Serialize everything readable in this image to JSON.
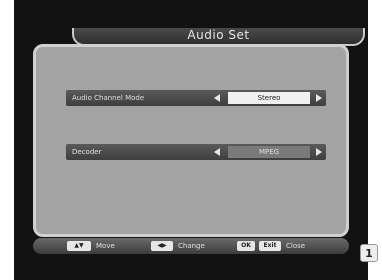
{
  "title": "Audio Set",
  "settings": [
    {
      "label": "Audio Channel Mode",
      "value": "Stereo"
    },
    {
      "label": "Decoder",
      "value": "MPEG"
    }
  ],
  "footer": {
    "move_key": "▲▼",
    "move_label": "Move",
    "change_key": "◀▶",
    "change_label": "Change",
    "ok_key": "OK",
    "exit_key": "Exit",
    "close_label": "Close"
  },
  "badge_text": "1",
  "colors": {
    "panel": "#a3a3a3",
    "bar": "#4a4a4a",
    "highlight": "#f0f0f0"
  }
}
